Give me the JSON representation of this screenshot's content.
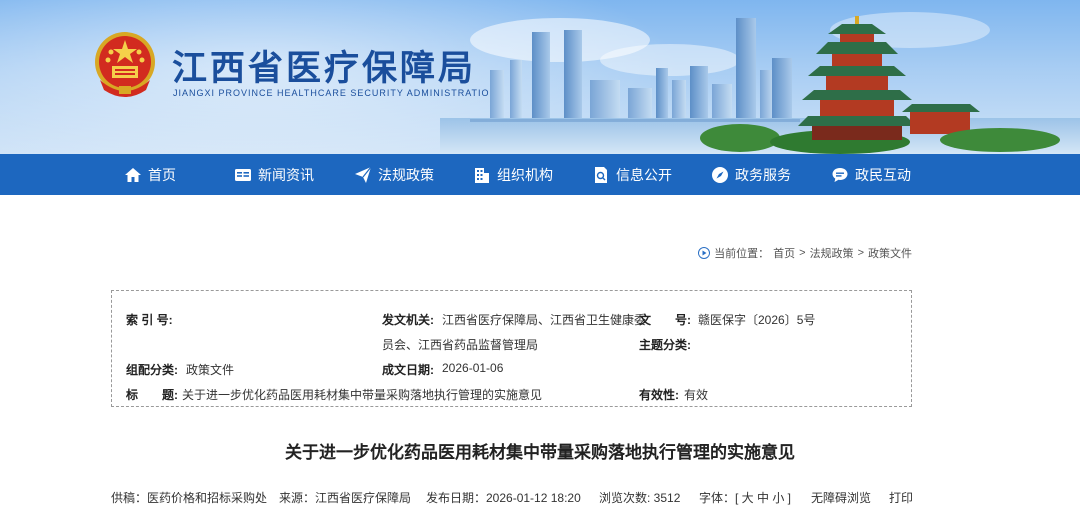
{
  "header": {
    "title": "江西省医疗保障局",
    "subtitle": "JIANGXI PROVINCE HEALTHCARE SECURITY ADMINISTRATION",
    "brand_color": "#1a4e9c",
    "emblem_icon": "national-emblem"
  },
  "nav": {
    "background": "#1d67bf",
    "items": [
      {
        "label": "首页",
        "icon": "home-icon"
      },
      {
        "label": "新闻资讯",
        "icon": "news-icon"
      },
      {
        "label": "法规政策",
        "icon": "paper-plane-icon"
      },
      {
        "label": "组织机构",
        "icon": "building-icon"
      },
      {
        "label": "信息公开",
        "icon": "document-icon"
      },
      {
        "label": "政务服务",
        "icon": "compass-icon"
      },
      {
        "label": "政民互动",
        "icon": "chat-icon"
      }
    ]
  },
  "breadcrumb": {
    "prefix": "当前位置：",
    "items": [
      "首页",
      "法规政策",
      "政策文件"
    ],
    "separator": ">"
  },
  "meta": {
    "index_no_label": "索 引 号:",
    "index_no": "",
    "issuer_label": "发文机关:",
    "issuer_line1": "江西省医疗保障局、江西省卫生健康委",
    "issuer_line2": "员会、江西省药品监督管理局",
    "doc_no_label": "文　　号:",
    "doc_no": "赣医保字〔2026〕5号",
    "topic_label": "主题分类:",
    "topic": "",
    "category_label": "组配分类:",
    "category": "政策文件",
    "date_label": "成文日期:",
    "date": "2026-01-06",
    "title_label": "标　　题:",
    "title": "关于进一步优化药品医用耗材集中带量采购落地执行管理的实施意见",
    "validity_label": "有效性:",
    "validity": "有效"
  },
  "article": {
    "title": "关于进一步优化药品医用耗材集中带量采购落地执行管理的实施意见",
    "supplier": "供稿：医药价格和招标采购处",
    "source": "来源：江西省医疗保障局",
    "publish": "发布日期：2026-01-12 18:20",
    "views": "浏览次数: 3512",
    "font_size": "字体：[ 大 中 小 ]",
    "accessible": "无障碍浏览",
    "print": "打印"
  }
}
